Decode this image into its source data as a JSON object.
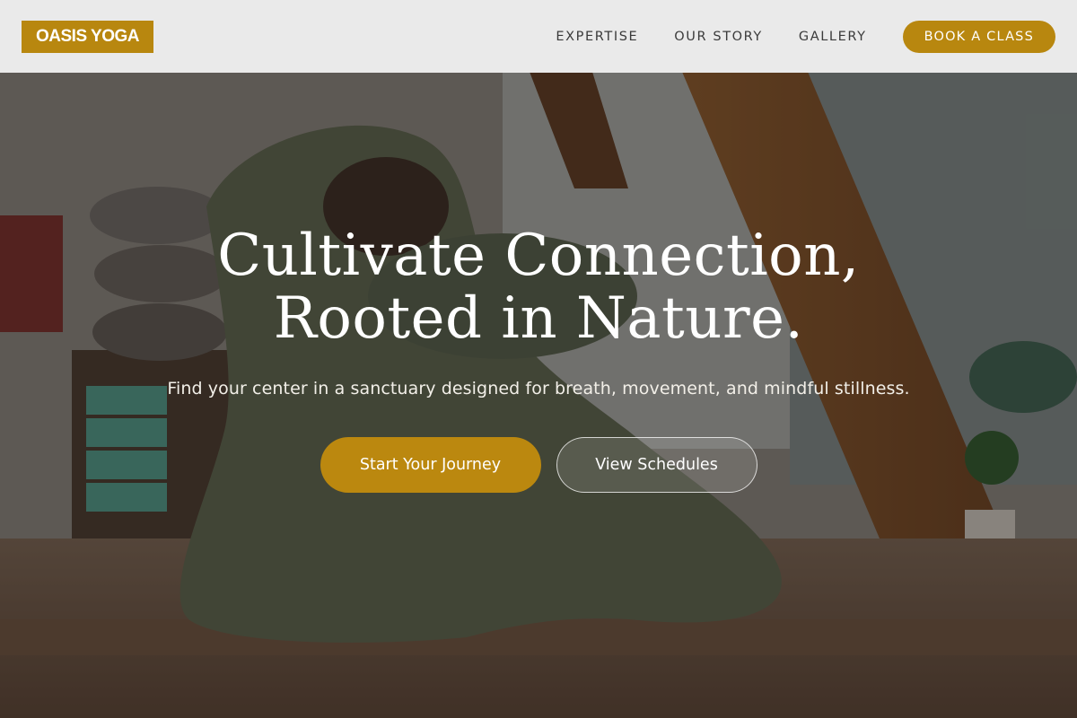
{
  "brand": {
    "logo_text": "OASIS YOGA"
  },
  "nav": {
    "links": [
      "EXPERTISE",
      "OUR STORY",
      "GALLERY"
    ],
    "cta_label": "BOOK A CLASS"
  },
  "hero": {
    "headline_line1": "Cultivate Connection,",
    "headline_line2": "Rooted in Nature.",
    "subtitle": "Find your center in a sanctuary designed for breath, movement, and mindful stillness.",
    "primary_button": "Start Your Journey",
    "secondary_button": "View Schedules",
    "image_alt": "woman-yoga-pose-photo"
  },
  "colors": {
    "accent": "#b8870f",
    "nav_background": "#f0f0f0",
    "nav_text": "#3a3a3a"
  }
}
